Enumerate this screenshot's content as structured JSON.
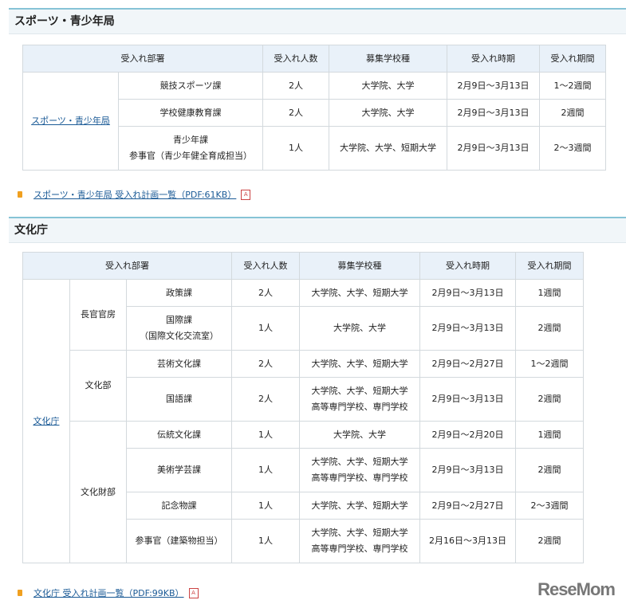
{
  "header_labels": [
    "受入れ部署",
    "受入れ人数",
    "募集学校種",
    "受入れ時期",
    "受入れ期間"
  ],
  "sections": [
    {
      "title": "スポーツ・青少年局",
      "link": "スポーツ・青少年局 受入れ計画一覧（PDF:61KB）",
      "agency": "スポーツ・青少年局",
      "groups": [
        {
          "name": null,
          "rows": [
            {
              "unit": [
                "競技スポーツ課"
              ],
              "count": "2人",
              "schools": [
                "大学院、大学"
              ],
              "period": "2月9日～3月13日",
              "duration": "1～2週間"
            },
            {
              "unit": [
                "学校健康教育課"
              ],
              "count": "2人",
              "schools": [
                "大学院、大学"
              ],
              "period": "2月9日～3月13日",
              "duration": "2週間"
            },
            {
              "unit": [
                "青少年課",
                "参事官（青少年健全育成担当）"
              ],
              "count": "1人",
              "schools": [
                "大学院、大学、短期大学"
              ],
              "period": "2月9日～3月13日",
              "duration": "2～3週間"
            }
          ]
        }
      ]
    },
    {
      "title": "文化庁",
      "link": "文化庁 受入れ計画一覧（PDF:99KB）",
      "agency": "文化庁",
      "groups": [
        {
          "name": "長官官房",
          "rows": [
            {
              "unit": [
                "政策課"
              ],
              "count": "2人",
              "schools": [
                "大学院、大学、短期大学"
              ],
              "period": "2月9日～3月13日",
              "duration": "1週間"
            },
            {
              "unit": [
                "国際課",
                "（国際文化交流室）"
              ],
              "count": "1人",
              "schools": [
                "大学院、大学"
              ],
              "period": "2月9日～3月13日",
              "duration": "2週間"
            }
          ]
        },
        {
          "name": "文化部",
          "rows": [
            {
              "unit": [
                "芸術文化課"
              ],
              "count": "2人",
              "schools": [
                "大学院、大学、短期大学"
              ],
              "period": "2月9日～2月27日",
              "duration": "1～2週間"
            },
            {
              "unit": [
                "国語課"
              ],
              "count": "2人",
              "schools": [
                "大学院、大学、短期大学",
                "高等専門学校、専門学校"
              ],
              "period": "2月9日～3月13日",
              "duration": "2週間"
            }
          ]
        },
        {
          "name": "文化財部",
          "rows": [
            {
              "unit": [
                "伝統文化課"
              ],
              "count": "1人",
              "schools": [
                "大学院、大学"
              ],
              "period": "2月9日～2月20日",
              "duration": "1週間"
            },
            {
              "unit": [
                "美術学芸課"
              ],
              "count": "1人",
              "schools": [
                "大学院、大学、短期大学",
                "高等専門学校、専門学校"
              ],
              "period": "2月9日～3月13日",
              "duration": "2週間"
            },
            {
              "unit": [
                "記念物課"
              ],
              "count": "1人",
              "schools": [
                "大学院、大学、短期大学"
              ],
              "period": "2月9日～2月27日",
              "duration": "2～3週間"
            },
            {
              "unit": [
                "参事官（建築物担当）"
              ],
              "count": "1人",
              "schools": [
                "大学院、大学、短期大学",
                "高等専門学校、専門学校"
              ],
              "period": "2月16日～3月13日",
              "duration": "2週間"
            }
          ]
        }
      ]
    }
  ],
  "logo": "ReseMom"
}
